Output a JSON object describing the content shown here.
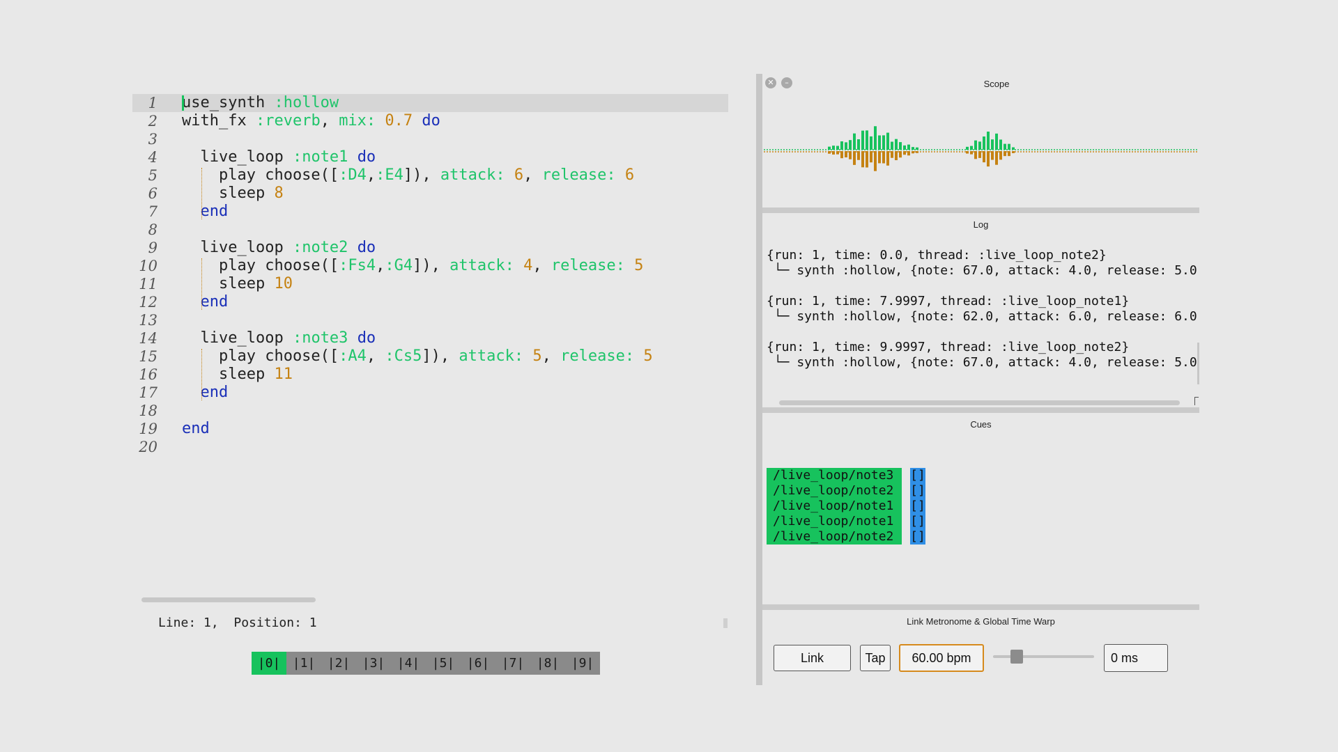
{
  "editor": {
    "lines": [
      {
        "n": "1",
        "tokens": [
          [
            "use_synth ",
            "plain"
          ],
          [
            ":hollow",
            "sym"
          ]
        ]
      },
      {
        "n": "2",
        "tokens": [
          [
            "with_fx ",
            "plain"
          ],
          [
            ":reverb",
            "sym"
          ],
          [
            ", ",
            "plain"
          ],
          [
            "mix:",
            "key"
          ],
          [
            " ",
            "plain"
          ],
          [
            "0.7",
            "num"
          ],
          [
            " ",
            "plain"
          ],
          [
            "do",
            "kw"
          ]
        ]
      },
      {
        "n": "3",
        "tokens": []
      },
      {
        "n": "4",
        "tokens": [
          [
            "  live_loop ",
            "plain"
          ],
          [
            ":note1",
            "sym"
          ],
          [
            " ",
            "plain"
          ],
          [
            "do",
            "kw"
          ]
        ]
      },
      {
        "n": "5",
        "tokens": [
          [
            "    play choose([",
            "plain"
          ],
          [
            ":D4",
            "sym"
          ],
          [
            ",",
            "plain"
          ],
          [
            ":E4",
            "sym"
          ],
          [
            "]), ",
            "plain"
          ],
          [
            "attack:",
            "key"
          ],
          [
            " ",
            "plain"
          ],
          [
            "6",
            "num"
          ],
          [
            ", ",
            "plain"
          ],
          [
            "release:",
            "key"
          ],
          [
            " ",
            "plain"
          ],
          [
            "6",
            "num"
          ]
        ]
      },
      {
        "n": "6",
        "tokens": [
          [
            "    sleep ",
            "plain"
          ],
          [
            "8",
            "num"
          ]
        ]
      },
      {
        "n": "7",
        "tokens": [
          [
            "  ",
            "plain"
          ],
          [
            "end",
            "kw"
          ]
        ]
      },
      {
        "n": "8",
        "tokens": []
      },
      {
        "n": "9",
        "tokens": [
          [
            "  live_loop ",
            "plain"
          ],
          [
            ":note2",
            "sym"
          ],
          [
            " ",
            "plain"
          ],
          [
            "do",
            "kw"
          ]
        ]
      },
      {
        "n": "10",
        "tokens": [
          [
            "    play choose([",
            "plain"
          ],
          [
            ":Fs4",
            "sym"
          ],
          [
            ",",
            "plain"
          ],
          [
            ":G4",
            "sym"
          ],
          [
            "]), ",
            "plain"
          ],
          [
            "attack:",
            "key"
          ],
          [
            " ",
            "plain"
          ],
          [
            "4",
            "num"
          ],
          [
            ", ",
            "plain"
          ],
          [
            "release:",
            "key"
          ],
          [
            " ",
            "plain"
          ],
          [
            "5",
            "num"
          ]
        ]
      },
      {
        "n": "11",
        "tokens": [
          [
            "    sleep ",
            "plain"
          ],
          [
            "10",
            "num"
          ]
        ]
      },
      {
        "n": "12",
        "tokens": [
          [
            "  ",
            "plain"
          ],
          [
            "end",
            "kw"
          ]
        ]
      },
      {
        "n": "13",
        "tokens": []
      },
      {
        "n": "14",
        "tokens": [
          [
            "  live_loop ",
            "plain"
          ],
          [
            ":note3",
            "sym"
          ],
          [
            " ",
            "plain"
          ],
          [
            "do",
            "kw"
          ]
        ]
      },
      {
        "n": "15",
        "tokens": [
          [
            "    play choose([",
            "plain"
          ],
          [
            ":A4",
            "sym"
          ],
          [
            ", ",
            "plain"
          ],
          [
            ":Cs5",
            "sym"
          ],
          [
            "]), ",
            "plain"
          ],
          [
            "attack:",
            "key"
          ],
          [
            " ",
            "plain"
          ],
          [
            "5",
            "num"
          ],
          [
            ", ",
            "plain"
          ],
          [
            "release:",
            "key"
          ],
          [
            " ",
            "plain"
          ],
          [
            "5",
            "num"
          ]
        ]
      },
      {
        "n": "16",
        "tokens": [
          [
            "    sleep ",
            "plain"
          ],
          [
            "11",
            "num"
          ]
        ]
      },
      {
        "n": "17",
        "tokens": [
          [
            "  ",
            "plain"
          ],
          [
            "end",
            "kw"
          ]
        ]
      },
      {
        "n": "18",
        "tokens": []
      },
      {
        "n": "19",
        "tokens": [
          [
            "end",
            "kw"
          ]
        ]
      },
      {
        "n": "20",
        "tokens": []
      }
    ],
    "current_line": 1
  },
  "status": {
    "text": "Line: 1,  Position: 1"
  },
  "buffers": {
    "tabs": [
      "|0|",
      "|1|",
      "|2|",
      "|3|",
      "|4|",
      "|5|",
      "|6|",
      "|7|",
      "|8|",
      "|9|"
    ],
    "active": 0
  },
  "scope": {
    "title": "Scope",
    "close_glyph": "✕",
    "minimize_glyph": "–",
    "colors": {
      "positive": "#17c25d",
      "negative": "#c58212"
    }
  },
  "log": {
    "title": "Log",
    "entries": [
      {
        "header": "{run: 1, time: 0.0, thread: :live_loop_note2}",
        "detail": " └─ synth :hollow, {note: 67.0, attack: 4.0, release: 5.0"
      },
      {
        "header": "{run: 1, time: 7.9997, thread: :live_loop_note1}",
        "detail": " └─ synth :hollow, {note: 62.0, attack: 6.0, release: 6.0"
      },
      {
        "header": "{run: 1, time: 9.9997, thread: :live_loop_note2}",
        "detail": " └─ synth :hollow, {note: 67.0, attack: 4.0, release: 5.0"
      }
    ]
  },
  "cues": {
    "title": "Cues",
    "items": [
      {
        "path": "/live_loop/note3",
        "value": "[]"
      },
      {
        "path": "/live_loop/note2",
        "value": "[]"
      },
      {
        "path": "/live_loop/note1",
        "value": "[]"
      },
      {
        "path": "/live_loop/note1",
        "value": "[]"
      },
      {
        "path": "/live_loop/note2",
        "value": "[]"
      }
    ]
  },
  "metronome": {
    "title": "Link Metronome & Global Time Warp",
    "link_label": "Link",
    "tap_label": "Tap",
    "bpm": "60.00 bpm",
    "time_warp": "0 ms",
    "slider_level": 0.2
  }
}
